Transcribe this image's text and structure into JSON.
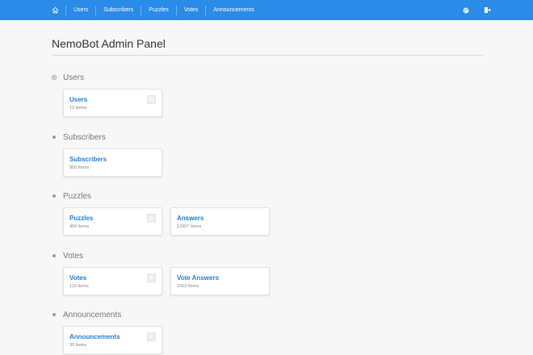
{
  "nav": {
    "home_icon": "home-icon",
    "items": [
      {
        "label": "Users"
      },
      {
        "label": "Subscribers"
      },
      {
        "label": "Puzzles"
      },
      {
        "label": "Votes"
      },
      {
        "label": "Announcements"
      }
    ],
    "right_icons": [
      "globe-icon",
      "logout-icon"
    ]
  },
  "page": {
    "title": "NemoBot Admin Panel"
  },
  "sections": [
    {
      "label": "Users",
      "icon": "gear-icon",
      "cards": [
        {
          "title": "Users",
          "count": "12 Items",
          "add_icon": "plus-icon"
        }
      ]
    },
    {
      "label": "Subscribers",
      "icon": "bullet-icon",
      "cards": [
        {
          "title": "Subscribers",
          "count": "950 Items"
        }
      ]
    },
    {
      "label": "Puzzles",
      "icon": "bullet-icon",
      "cards": [
        {
          "title": "Puzzles",
          "count": "456 Items",
          "add_icon": "plus-icon"
        },
        {
          "title": "Answers",
          "count": "12997 Items"
        }
      ]
    },
    {
      "label": "Votes",
      "icon": "bullet-icon",
      "cards": [
        {
          "title": "Votes",
          "count": "110 Items",
          "add_icon": "plus-icon"
        },
        {
          "title": "Vote Answers",
          "count": "3353 Items"
        }
      ]
    },
    {
      "label": "Announcements",
      "icon": "bullet-icon",
      "cards": [
        {
          "title": "Announcements",
          "count": "30 Items",
          "add_icon": "plus-icon"
        }
      ]
    }
  ],
  "colors": {
    "topbar": "#2a8be8",
    "link": "#1f7fd6",
    "background": "#f7f7f7"
  }
}
